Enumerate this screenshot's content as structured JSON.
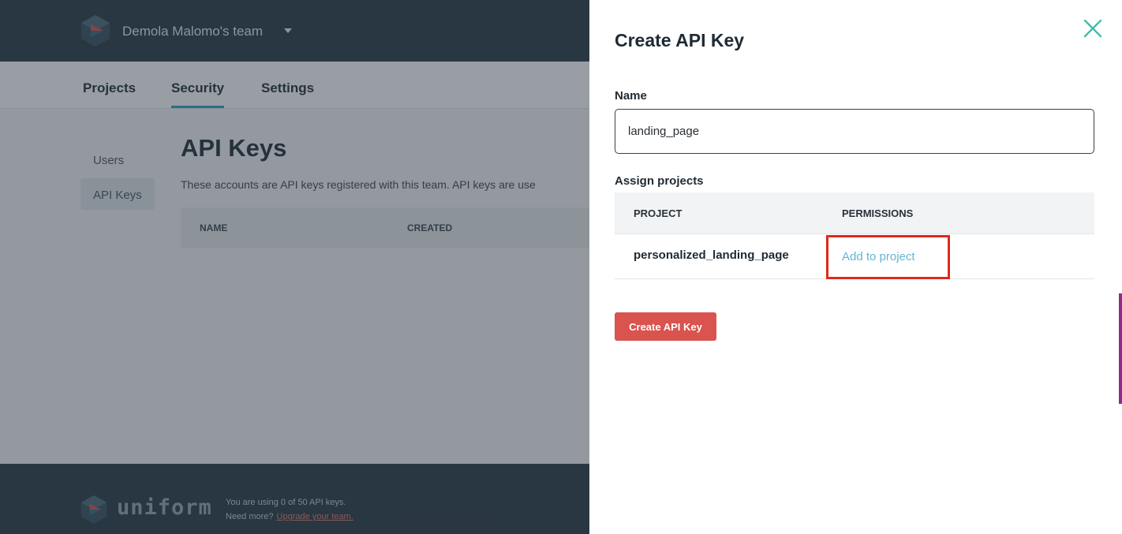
{
  "topbar": {
    "team_name": "Demola Malomo's team"
  },
  "subnav": {
    "tabs": [
      {
        "label": "Projects"
      },
      {
        "label": "Security"
      },
      {
        "label": "Settings"
      }
    ]
  },
  "sidebar": {
    "items": [
      {
        "label": "Users"
      },
      {
        "label": "API Keys"
      }
    ]
  },
  "main": {
    "title": "API Keys",
    "description": "These accounts are API keys registered with this team. API keys are use",
    "table_headers": [
      "NAME",
      "CREATED"
    ]
  },
  "footer": {
    "brand": "uniform",
    "usage_text": "You are using 0 of 50 API keys.",
    "need_more": "Need more?",
    "upgrade_link": "Upgrade your team."
  },
  "drawer": {
    "title": "Create API Key",
    "name_label": "Name",
    "name_value": "landing_page",
    "assign_label": "Assign projects",
    "table_headers": {
      "project": "PROJECT",
      "permissions": "PERMISSIONS"
    },
    "rows": [
      {
        "project": "personalized_landing_page",
        "action": "Add to project"
      }
    ],
    "create_button": "Create API Key"
  },
  "colors": {
    "accent": "#28a5c5",
    "primary_button": "#d9534f",
    "link": "#63b6d2",
    "highlight_box": "#e0291a",
    "topbar": "#2b3a45"
  }
}
